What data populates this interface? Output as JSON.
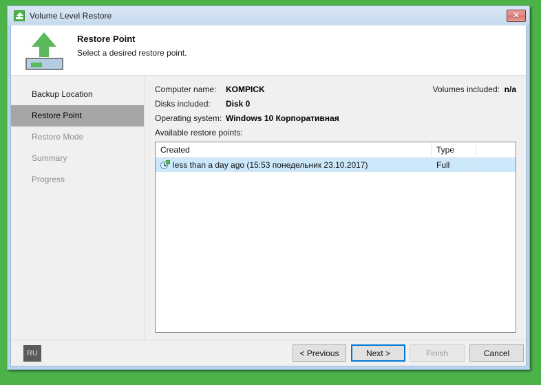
{
  "window": {
    "title": "Volume Level Restore",
    "icon": "volume-restore-icon",
    "close_label": "✕"
  },
  "header": {
    "title": "Restore Point",
    "subtitle": "Select a desired restore point.",
    "icon": "restore-drive-icon"
  },
  "sidebar": {
    "items": [
      {
        "label": "Backup Location",
        "state": "done"
      },
      {
        "label": "Restore Point",
        "state": "active"
      },
      {
        "label": "Restore Mode",
        "state": "pending"
      },
      {
        "label": "Summary",
        "state": "pending"
      },
      {
        "label": "Progress",
        "state": "pending"
      }
    ]
  },
  "main": {
    "info": {
      "computer_name_label": "Computer name:",
      "computer_name_value": "KOMPICK",
      "disks_included_label": "Disks included:",
      "disks_included_value": "Disk 0",
      "operating_system_label": "Operating system:",
      "operating_system_value": "Windows 10 Корпоративная",
      "volumes_included_label": "Volumes included:",
      "volumes_included_value": "n/a"
    },
    "list_caption": "Available restore points:",
    "columns": [
      "Created",
      "Type",
      ""
    ],
    "rows": [
      {
        "created": "less than a day ago (15:53 понедельник 23.10.2017)",
        "type": "Full",
        "icon": "restore-point-clock-icon",
        "selected": true
      }
    ]
  },
  "footer": {
    "language_indicator": "RU",
    "buttons": {
      "previous": "< Previous",
      "next": "Next >",
      "finish": "Finish",
      "cancel": "Cancel"
    }
  },
  "colors": {
    "desktop_background": "#4cb348",
    "accent_green": "#5cb85c",
    "focus_blue": "#0078d7",
    "selection_blue": "#cde8fb",
    "titlebar_blue": "#cfe0f0",
    "close_red": "#d4736d",
    "active_nav_gray": "#a6a6a6"
  }
}
